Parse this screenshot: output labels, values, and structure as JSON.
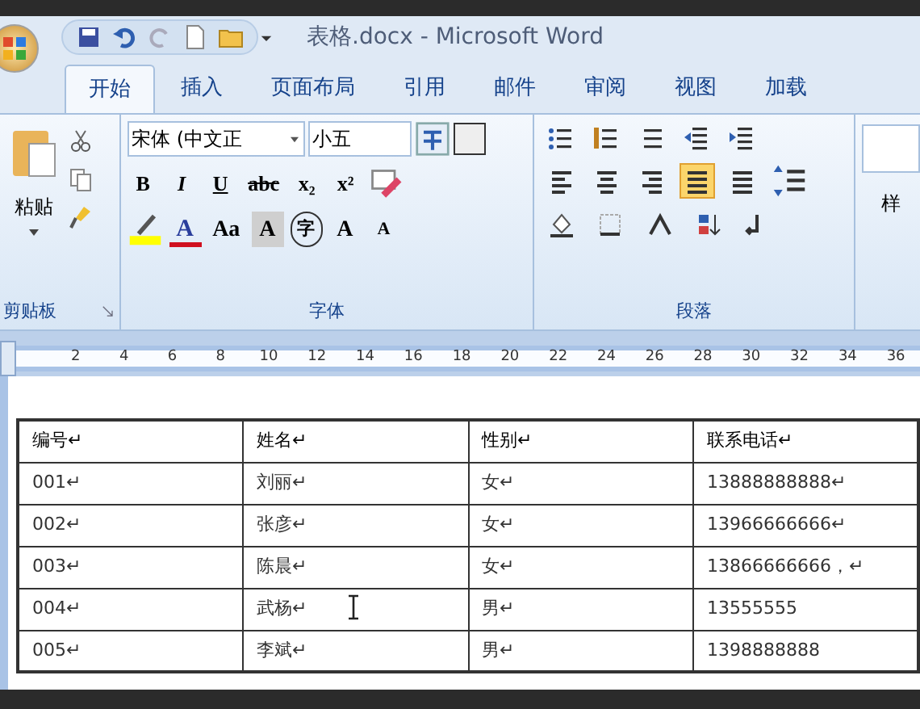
{
  "window": {
    "title": "表格.docx - Microsoft Word"
  },
  "tabs": [
    {
      "label": "开始",
      "selected": true
    },
    {
      "label": "插入",
      "selected": false
    },
    {
      "label": "页面布局",
      "selected": false
    },
    {
      "label": "引用",
      "selected": false
    },
    {
      "label": "邮件",
      "selected": false
    },
    {
      "label": "审阅",
      "selected": false
    },
    {
      "label": "视图",
      "selected": false
    },
    {
      "label": "加载",
      "selected": false
    }
  ],
  "clipboard": {
    "paste_label": "粘贴",
    "group_label": "剪贴板"
  },
  "font": {
    "font_name": "宋体 (中文正",
    "font_size": "小五",
    "group_label": "字体",
    "format_buttons": [
      "B",
      "I",
      "U",
      "abc",
      "x₂",
      "x²"
    ],
    "row3_buttons": [
      "A",
      "Aa",
      "A",
      "字",
      "A",
      "A"
    ]
  },
  "paragraph": {
    "group_label": "段落",
    "alignment": [
      {
        "selected": false
      },
      {
        "selected": false
      },
      {
        "selected": false
      },
      {
        "selected": true
      },
      {
        "selected": false
      }
    ]
  },
  "styles": {
    "label": "样"
  },
  "ruler": {
    "ticks": [
      "2",
      "4",
      "6",
      "8",
      "10",
      "12",
      "14",
      "16",
      "18",
      "20",
      "22",
      "24",
      "26",
      "28",
      "30",
      "32",
      "34",
      "36"
    ]
  },
  "table": {
    "columns": [
      "编号↵",
      "姓名↵",
      "性别↵",
      "联系电话↵"
    ],
    "rows": [
      [
        "001↵",
        "刘丽↵",
        "女↵",
        "13888888888↵"
      ],
      [
        "002↵",
        "张彦↵",
        "女↵",
        "13966666666↵"
      ],
      [
        "003↵",
        "陈晨↵",
        "女↵",
        "13866666666，↵"
      ],
      [
        "004↵",
        "武杨↵",
        "男↵",
        "13555555"
      ],
      [
        "005↵",
        "李斌↵",
        "男↵",
        "1398888888"
      ]
    ]
  }
}
